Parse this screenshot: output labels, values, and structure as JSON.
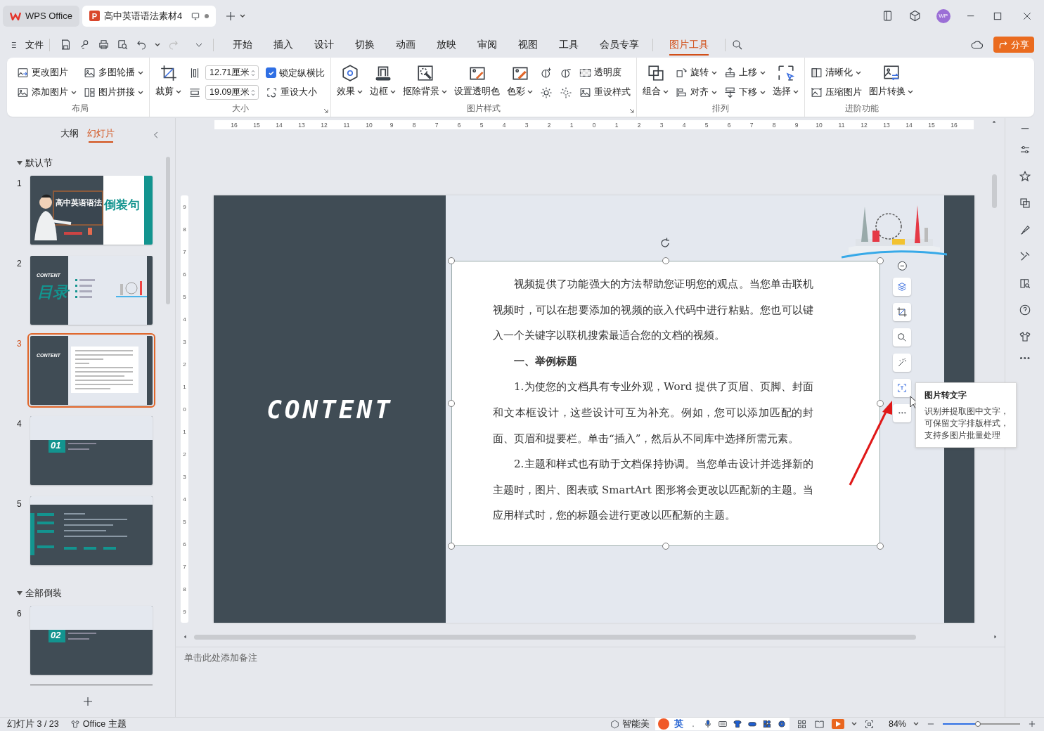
{
  "title_bar": {
    "tabs": [
      {
        "label": "WPS Office",
        "kind": "home",
        "selected": false
      },
      {
        "label": "高中英语语法素材4",
        "kind": "document",
        "icon_letter": "P",
        "selected": true
      }
    ],
    "avatar": "WP"
  },
  "menu": {
    "file": "文件",
    "tabs": [
      {
        "label": "开始",
        "selected": false
      },
      {
        "label": "插入",
        "selected": false
      },
      {
        "label": "设计",
        "selected": false
      },
      {
        "label": "切换",
        "selected": false
      },
      {
        "label": "动画",
        "selected": false
      },
      {
        "label": "放映",
        "selected": false
      },
      {
        "label": "审阅",
        "selected": false
      },
      {
        "label": "视图",
        "selected": false
      },
      {
        "label": "工具",
        "selected": false
      },
      {
        "label": "会员专享",
        "selected": false
      },
      {
        "label": "图片工具",
        "selected": true
      }
    ],
    "share": "分享"
  },
  "ribbon": {
    "groups": [
      {
        "title": "布局",
        "launcher": false,
        "columns": [
          {
            "kind": "stack",
            "items": [
              {
                "kind": "button",
                "label": "更改图片",
                "dropdown": false
              },
              {
                "kind": "button",
                "label": "添加图片",
                "dropdown": true
              }
            ]
          },
          {
            "kind": "stack",
            "items": [
              {
                "kind": "button",
                "label": "多图轮播",
                "dropdown": true
              },
              {
                "kind": "button",
                "label": "图片拼接",
                "dropdown": true
              }
            ]
          }
        ]
      },
      {
        "title": "大小",
        "launcher": true,
        "columns": [
          {
            "kind": "large",
            "label": "裁剪",
            "dropdown": true
          },
          {
            "kind": "stack",
            "items": [
              {
                "kind": "spin",
                "value": "12.71厘米"
              },
              {
                "kind": "spin",
                "value": "19.09厘米"
              }
            ]
          },
          {
            "kind": "stack",
            "items": [
              {
                "kind": "check",
                "label": "锁定纵横比",
                "checked": true
              },
              {
                "kind": "button",
                "label": "重设大小",
                "dropdown": false
              }
            ]
          }
        ]
      },
      {
        "title": "图片样式",
        "launcher": true,
        "columns": [
          {
            "kind": "large",
            "label": "效果",
            "dropdown": true
          },
          {
            "kind": "large",
            "label": "边框",
            "dropdown": true
          },
          {
            "kind": "large",
            "label": "抠除背景",
            "dropdown": true
          },
          {
            "kind": "large",
            "label": "设置透明色",
            "dropdown": false
          },
          {
            "kind": "large",
            "label": "色彩",
            "dropdown": true
          },
          {
            "kind": "stack",
            "items": [
              {
                "kind": "icon"
              },
              {
                "kind": "icon"
              }
            ]
          },
          {
            "kind": "stack",
            "items": [
              {
                "kind": "icon"
              },
              {
                "kind": "icon"
              }
            ]
          },
          {
            "kind": "stack",
            "items": [
              {
                "kind": "button",
                "label": "透明度",
                "dropdown": false
              },
              {
                "kind": "button",
                "label": "重设样式",
                "dropdown": false
              }
            ]
          }
        ]
      },
      {
        "title": "排列",
        "launcher": false,
        "columns": [
          {
            "kind": "large",
            "label": "组合",
            "dropdown": true
          },
          {
            "kind": "stack",
            "items": [
              {
                "kind": "button",
                "label": "旋转",
                "dropdown": true
              },
              {
                "kind": "button",
                "label": "对齐",
                "dropdown": true
              }
            ]
          },
          {
            "kind": "stack",
            "items": [
              {
                "kind": "button",
                "label": "上移",
                "dropdown": true
              },
              {
                "kind": "button",
                "label": "下移",
                "dropdown": true
              }
            ]
          },
          {
            "kind": "large",
            "label": "选择",
            "dropdown": true
          }
        ]
      },
      {
        "title": "进阶功能",
        "launcher": false,
        "columns": [
          {
            "kind": "stack",
            "items": [
              {
                "kind": "button",
                "label": "清晰化",
                "dropdown": true
              },
              {
                "kind": "button",
                "label": "压缩图片",
                "dropdown": false
              }
            ]
          },
          {
            "kind": "large",
            "label": "图片转换",
            "dropdown": true
          }
        ]
      }
    ]
  },
  "slide_panel": {
    "tabs": [
      {
        "label": "大纲",
        "selected": false
      },
      {
        "label": "幻灯片",
        "selected": true
      }
    ],
    "sections": [
      {
        "title": "默认节",
        "expanded": true,
        "slides": [
          {
            "number": "1",
            "kind": "title",
            "selected": false,
            "texts": [
              "高中英语语法",
              "倒装句"
            ]
          },
          {
            "number": "2",
            "kind": "toc",
            "selected": false,
            "texts": [
              "CONTENT",
              "目录"
            ]
          },
          {
            "number": "3",
            "kind": "content",
            "selected": true,
            "texts": [
              "CONTENT"
            ]
          },
          {
            "number": "4",
            "kind": "section",
            "selected": false,
            "texts": [
              "01"
            ]
          },
          {
            "number": "5",
            "kind": "list",
            "selected": false
          }
        ]
      },
      {
        "title": "全部倒装",
        "expanded": true,
        "slides": [
          {
            "number": "6",
            "kind": "section",
            "selected": false,
            "texts": [
              "02"
            ]
          }
        ]
      }
    ]
  },
  "ruler_h": [
    "16",
    "15",
    "14",
    "13",
    "12",
    "11",
    "10",
    "9",
    "8",
    "7",
    "6",
    "5",
    "4",
    "3",
    "2",
    "1",
    "0",
    "1",
    "2",
    "3",
    "4",
    "5",
    "6",
    "7",
    "8",
    "9",
    "10",
    "11",
    "12",
    "13",
    "14",
    "15",
    "16"
  ],
  "ruler_v": [
    "9",
    "8",
    "7",
    "6",
    "5",
    "4",
    "3",
    "2",
    "1",
    "0",
    "1",
    "2",
    "3",
    "4",
    "5",
    "6",
    "7",
    "8",
    "9"
  ],
  "slide": {
    "heading": "CONTENT",
    "paragraphs": [
      {
        "kind": "body",
        "text": "视频提供了功能强大的方法帮助您证明您的观点。当您单击联机视频时，可以在想要添加的视频的嵌入代码中进行粘贴。您也可以键入一个关键字以联机搜索最适合您的文档的视频。"
      },
      {
        "kind": "heading",
        "text": "一、举例标题"
      },
      {
        "kind": "body",
        "text": "1.为使您的文档具有专业外观，Word 提供了页眉、页脚、封面和文本框设计，这些设计可互为补充。例如，您可以添加匹配的封面、页眉和提要栏。单击“插入”，然后从不同库中选择所需元素。"
      },
      {
        "kind": "body",
        "text": "2.主题和样式也有助于文档保持协调。当您单击设计并选择新的主题时，图片、图表或 SmartArt 图形将会更改以匹配新的主题。当应用样式时，您的标题会进行更改以匹配新的主题。"
      }
    ],
    "tooltip": {
      "title": "图片转文字",
      "text": "识别并提取图中文字，可保留文字排版样式，支持多图片批量处理"
    }
  },
  "notes_placeholder": "单击此处添加备注",
  "status_bar": {
    "slide_count": "幻灯片 3 / 23",
    "theme": "Office 主题",
    "beautify": "智能美",
    "ime": "英",
    "zoom": "84%",
    "zoom_slider": {
      "level": 0.45
    }
  }
}
